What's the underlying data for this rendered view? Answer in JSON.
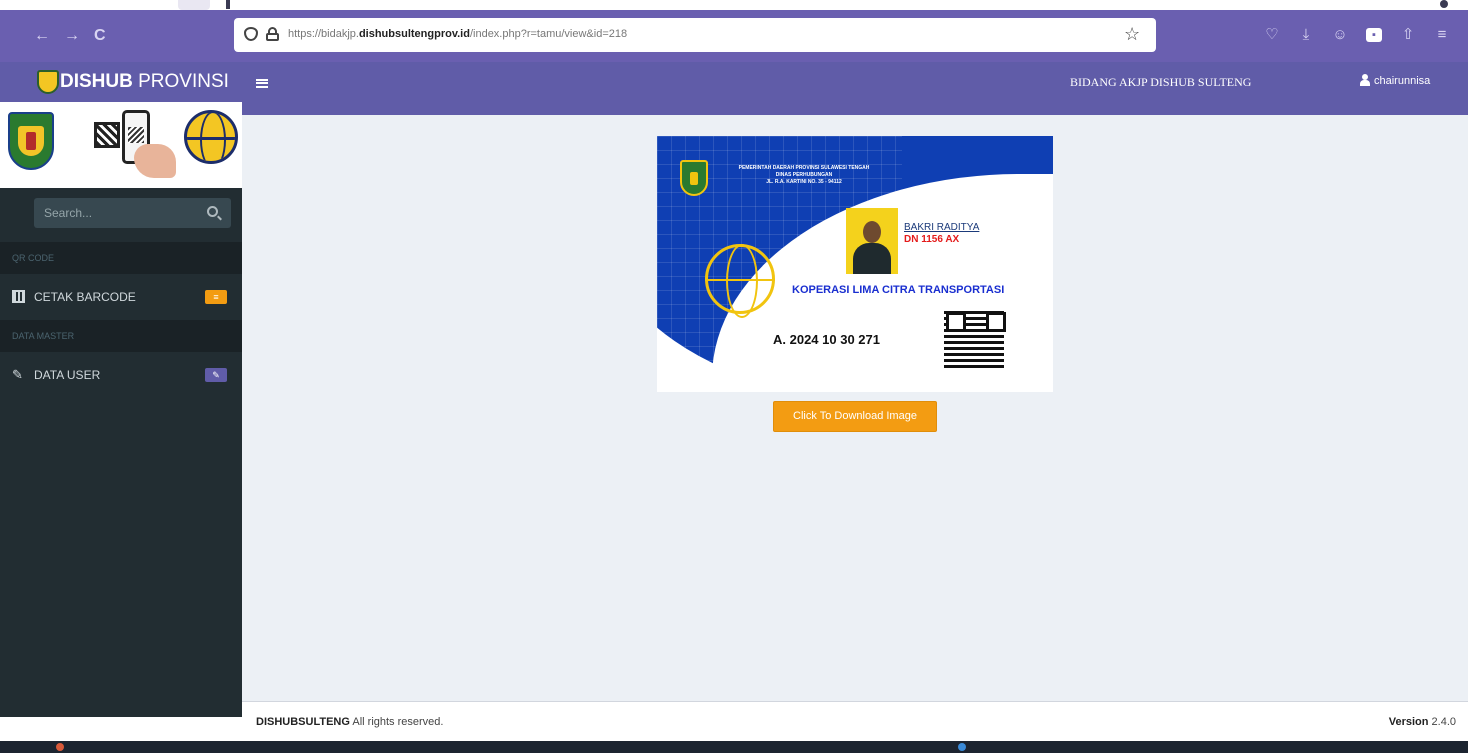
{
  "browser": {
    "back_icon": "←",
    "forward_icon": "→",
    "reload_icon": "C",
    "url_prefix": "https://bidakjp.",
    "url_domain": "dishubsultengprov.id",
    "url_path": "/index.php?r=tamu/view&id=218",
    "bookmark_icon": "☆",
    "toolbar_icons": [
      "♡",
      "⤓",
      "☺",
      "▪",
      "⇧",
      "≡"
    ]
  },
  "brand": {
    "title_bold": "DISHUB",
    "title_light": " PROVINSI"
  },
  "sidebar": {
    "search_placeholder": "Search...",
    "sections": [
      {
        "header": "QR CODE",
        "item_label": "CETAK BARCODE",
        "badge_color": "#f39c12"
      },
      {
        "header": "DATA MASTER",
        "item_label": "DATA USER",
        "badge_color": "#605ca8"
      }
    ]
  },
  "header": {
    "org_name": "BIDANG AKJP DISHUB SULTENG",
    "user_name": "chairunnisa"
  },
  "card": {
    "gov_line1": "PEMERINTAH DAERAH PROVINSI SULAWESI TENGAH",
    "gov_line2": "DINAS PERHUBUNGAN",
    "gov_line3": "JL. R.A. KARTINI NO. 35 - 94112",
    "holder_name": "BAKRI RADITYA",
    "plate_number": "DN 1156 AX",
    "company": "KOPERASI LIMA CITRA TRANSPORTASI",
    "reg_number": "A. 2024 10 30 271",
    "download_label": "Click To Download Image"
  },
  "footer": {
    "left_bold": "DISHUBSULTENG",
    "left_text": " All rights reserved.",
    "version_label": "Version",
    "version_value": " 2.4.0"
  },
  "colors": {
    "browser_bar": "#6a5fb0",
    "header": "#605ca8",
    "sidebar": "#222d32",
    "content_bg": "#ecf0f5",
    "download_button": "#f39c12",
    "card_blue": "#0f3fb3"
  }
}
